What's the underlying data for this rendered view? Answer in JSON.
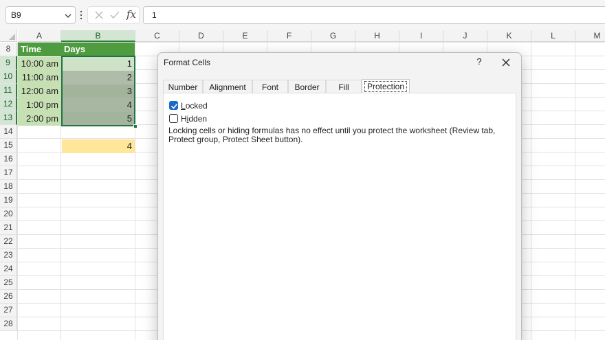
{
  "formula_bar": {
    "name_box": "B9",
    "fx_label": "fx",
    "value": "1"
  },
  "grid": {
    "columns": [
      "A",
      "B",
      "C",
      "D",
      "E",
      "F",
      "G",
      "H",
      "I",
      "J",
      "K",
      "L",
      "M"
    ],
    "selected_column": "B",
    "rows": [
      "8",
      "9",
      "10",
      "11",
      "12",
      "13",
      "14",
      "15",
      "16",
      "17",
      "18",
      "19",
      "20",
      "21",
      "22",
      "23",
      "24",
      "25",
      "26",
      "27",
      "28"
    ],
    "header_row": {
      "time": "Time",
      "days": "Days"
    },
    "data": [
      {
        "time": "10:00 am",
        "day": "1"
      },
      {
        "time": "11:00 am",
        "day": "2"
      },
      {
        "time": "12:00 am",
        "day": "3"
      },
      {
        "time": "1:00 pm",
        "day": "4"
      },
      {
        "time": "2:00 pm",
        "day": "5"
      }
    ],
    "result_cell": "4",
    "colors": {
      "header_green": "#4f9b3f",
      "time_fill": "#c6e0b4",
      "result_fill": "#ffe699",
      "selection": "#217346"
    }
  },
  "dialog": {
    "title": "Format Cells",
    "help": "?",
    "tabs": [
      "Number",
      "Alignment",
      "Font",
      "Border",
      "Fill",
      "Protection"
    ],
    "active_tab": "Protection",
    "locked_label": "Locked",
    "locked_checked": true,
    "hidden_label": "Hidden",
    "hidden_checked": false,
    "note": "Locking cells or hiding formulas has no effect until you protect the worksheet (Review tab, Protect group, Protect Sheet button)."
  }
}
